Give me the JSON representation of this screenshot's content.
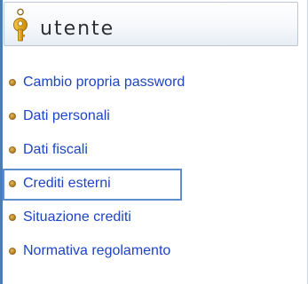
{
  "header": {
    "title": "utente",
    "icon": "user-key-icon"
  },
  "menu": {
    "bullet_color": "#b8842c",
    "link_color": "#1d44c2",
    "items": [
      {
        "label": "Cambio propria password"
      },
      {
        "label": "Dati personali"
      },
      {
        "label": "Dati fiscali"
      },
      {
        "label": "Crediti esterni",
        "selected": true
      },
      {
        "label": "Situazione crediti"
      },
      {
        "label": "Normativa regolamento"
      }
    ]
  },
  "colors": {
    "accent": "#4a7db6",
    "selection_border": "#5b8fc9"
  }
}
